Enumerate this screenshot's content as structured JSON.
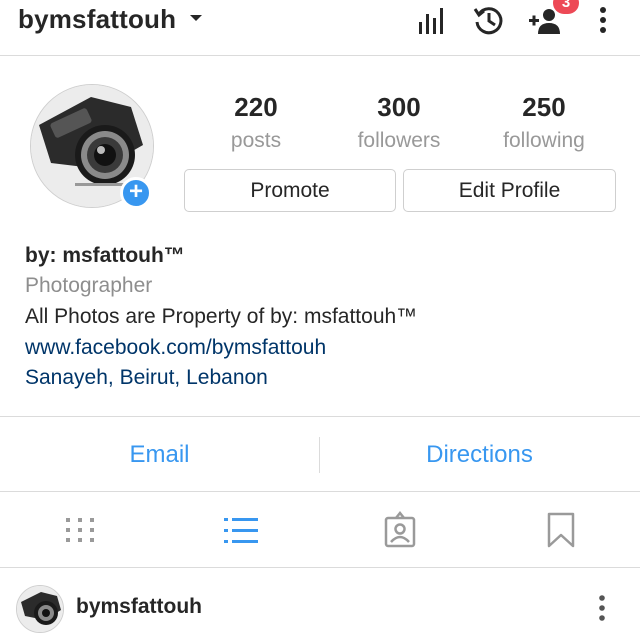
{
  "topbar": {
    "username": "bymsfattouh",
    "icons": [
      "chevron-down-icon",
      "insights-icon",
      "archive-icon",
      "discover-people-icon",
      "more-icon"
    ],
    "notification_count": "3"
  },
  "profile": {
    "stats": [
      {
        "value": "220",
        "label": "posts"
      },
      {
        "value": "300",
        "label": "followers"
      },
      {
        "value": "250",
        "label": "following"
      }
    ],
    "promote_label": "Promote",
    "edit_label": "Edit Profile"
  },
  "bio": {
    "name": "by: msfattouh™",
    "category": "Photographer",
    "text": "All Photos are Property of by: msfattouh™",
    "link": "www.facebook.com/bymsfattouh",
    "location": "Sanayeh, Beirut, Lebanon"
  },
  "contact": {
    "email_label": "Email",
    "directions_label": "Directions"
  },
  "tabs": {
    "items": [
      "grid-icon",
      "list-icon",
      "tagged-icon",
      "saved-icon"
    ],
    "active": "list-icon",
    "active_color": "#3897f0"
  },
  "post": {
    "username": "bymsfattouh"
  },
  "colors": {
    "accent": "#3897f0",
    "badge": "#ed4956",
    "link": "#003569"
  }
}
